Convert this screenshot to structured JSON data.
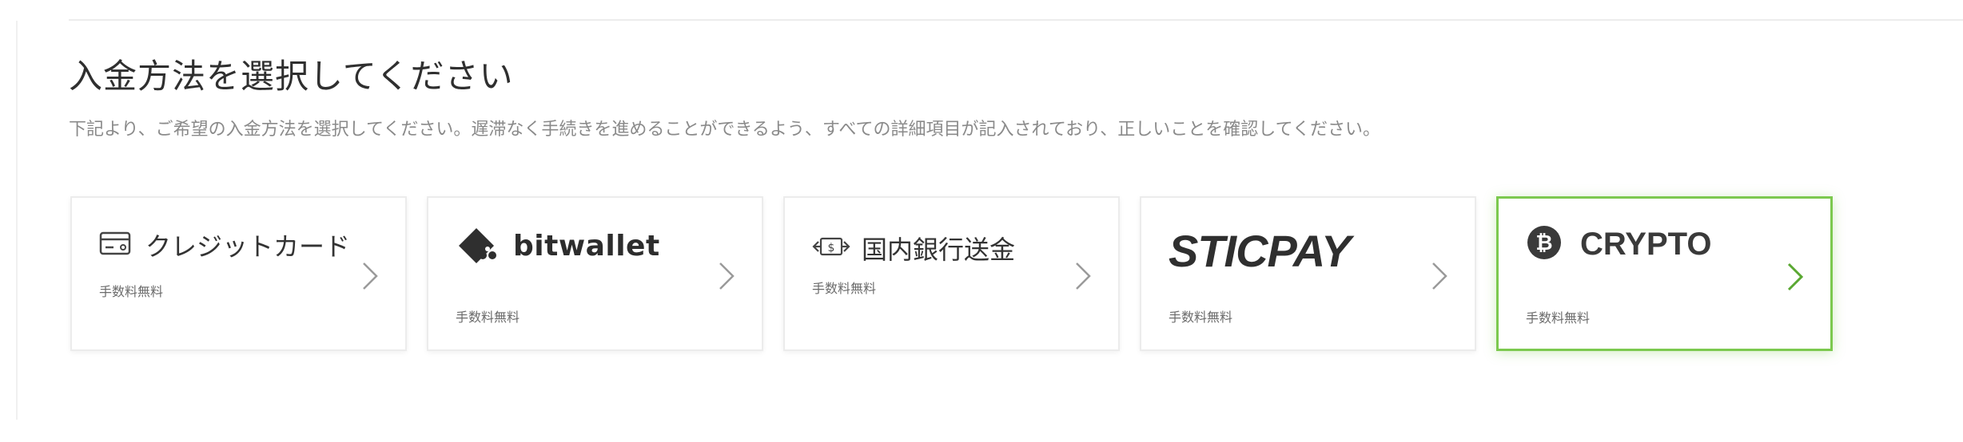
{
  "page": {
    "title": "入金方法を選択してください",
    "subtitle": "下記より、ご希望の入金方法を選択してください。遅滞なく手続きを進めることができるよう、すべての詳細項目が記入されており、正しいことを確認してください。"
  },
  "methods": [
    {
      "label": "クレジットカード",
      "fee": "手数料無料",
      "icon": "credit-card-icon",
      "selected": false
    },
    {
      "label": "bitwallet",
      "fee": "手数料無料",
      "icon": "bitwallet-logo-icon",
      "selected": false
    },
    {
      "label": "国内銀行送金",
      "fee": "手数料無料",
      "icon": "bank-transfer-icon",
      "selected": false
    },
    {
      "label": "STICPAY",
      "fee": "手数料無料",
      "icon": "sticpay-logo",
      "selected": false
    },
    {
      "label": "CRYPTO",
      "fee": "手数料無料",
      "icon": "bitcoin-icon",
      "selected": true
    }
  ],
  "colors": {
    "selected_border": "#7cc94f",
    "chevron_default": "#9a9a9a",
    "chevron_selected": "#5aa832"
  }
}
